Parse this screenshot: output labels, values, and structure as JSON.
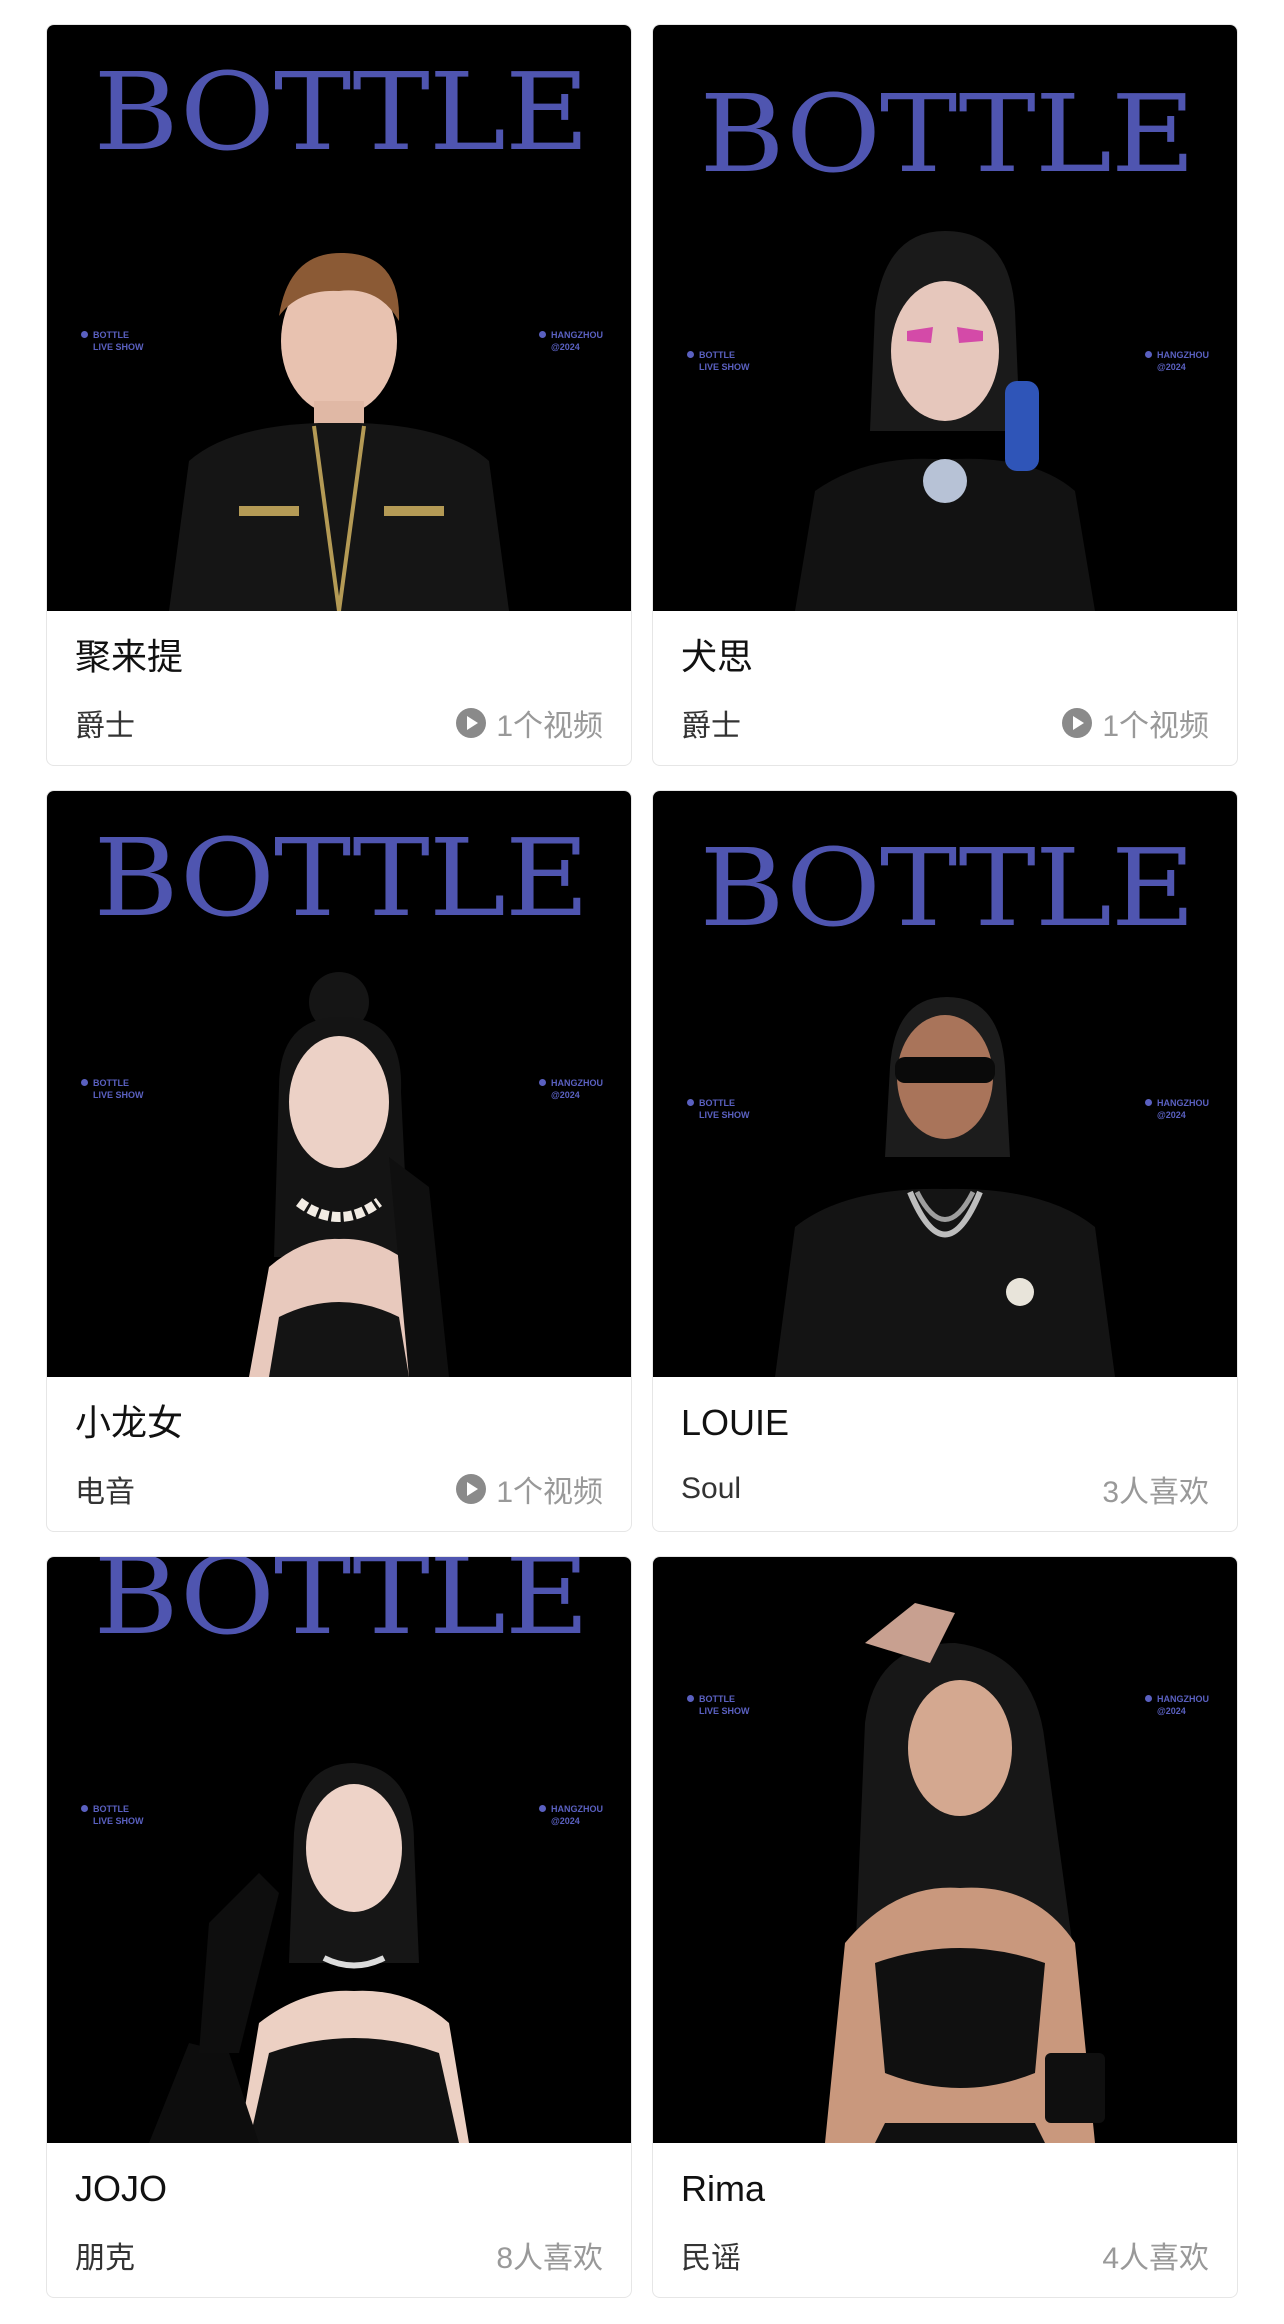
{
  "brand": {
    "logo_text": "BOTTLE",
    "tag_left_line1": "BOTTLE",
    "tag_left_line2": "LIVE SHOW",
    "tag_right_line1": "HANGZHOU",
    "tag_right_line2": "@2024",
    "accent_color": "#4f55b0"
  },
  "cards": [
    {
      "name": "聚来提",
      "genre": "爵士",
      "meta": "1个视频",
      "meta_icon": "play-circle-icon"
    },
    {
      "name": "犬思",
      "genre": "爵士",
      "meta": "1个视频",
      "meta_icon": "play-circle-icon"
    },
    {
      "name": "小龙女",
      "genre": "电音",
      "meta": "1个视频",
      "meta_icon": "play-circle-icon"
    },
    {
      "name": "LOUIE",
      "genre": "Soul",
      "meta": "3人喜欢",
      "meta_icon": ""
    },
    {
      "name": "JOJO",
      "genre": "朋克",
      "meta": "8人喜欢",
      "meta_icon": ""
    },
    {
      "name": "Rima",
      "genre": "民谣",
      "meta": "4人喜欢",
      "meta_icon": ""
    }
  ]
}
